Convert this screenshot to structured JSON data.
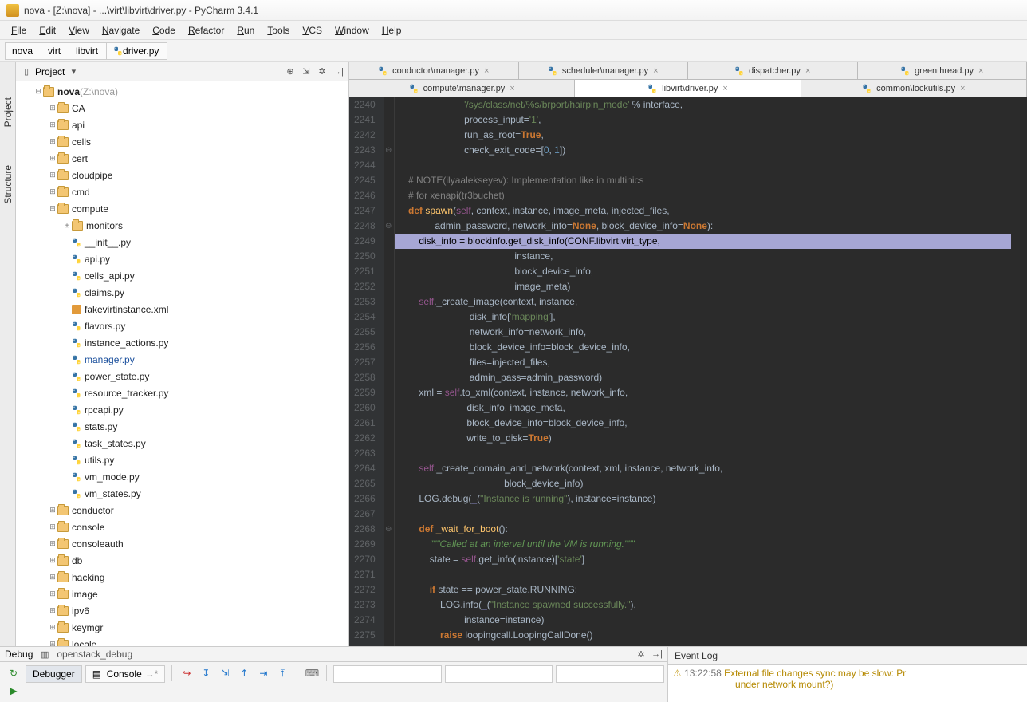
{
  "window": {
    "title": "nova - [Z:\\nova] - ...\\virt\\libvirt\\driver.py - PyCharm 3.4.1"
  },
  "menu": [
    "File",
    "Edit",
    "View",
    "Navigate",
    "Code",
    "Refactor",
    "Run",
    "Tools",
    "VCS",
    "Window",
    "Help"
  ],
  "breadcrumbs": [
    {
      "label": "nova",
      "icon": "folder"
    },
    {
      "label": "virt",
      "icon": "none"
    },
    {
      "label": "libvirt",
      "icon": "none"
    },
    {
      "label": "driver.py",
      "icon": "python"
    }
  ],
  "side_tabs": [
    "Project",
    "Structure"
  ],
  "project_panel": {
    "title": "Project",
    "root": {
      "label": "nova",
      "hint": "(Z:\\nova)"
    }
  },
  "tree": [
    {
      "depth": 0,
      "exp": "-",
      "icon": "folder",
      "label": "nova",
      "hint": "(Z:\\nova)",
      "bold": true
    },
    {
      "depth": 1,
      "exp": "+",
      "icon": "folder",
      "label": "CA"
    },
    {
      "depth": 1,
      "exp": "+",
      "icon": "folder",
      "label": "api"
    },
    {
      "depth": 1,
      "exp": "+",
      "icon": "folder",
      "label": "cells"
    },
    {
      "depth": 1,
      "exp": "+",
      "icon": "folder",
      "label": "cert"
    },
    {
      "depth": 1,
      "exp": "+",
      "icon": "folder",
      "label": "cloudpipe"
    },
    {
      "depth": 1,
      "exp": "+",
      "icon": "folder",
      "label": "cmd"
    },
    {
      "depth": 1,
      "exp": "-",
      "icon": "folder",
      "label": "compute"
    },
    {
      "depth": 2,
      "exp": "+",
      "icon": "folder",
      "label": "monitors"
    },
    {
      "depth": 2,
      "exp": "",
      "icon": "python",
      "label": "__init__.py"
    },
    {
      "depth": 2,
      "exp": "",
      "icon": "python",
      "label": "api.py"
    },
    {
      "depth": 2,
      "exp": "",
      "icon": "python",
      "label": "cells_api.py"
    },
    {
      "depth": 2,
      "exp": "",
      "icon": "python",
      "label": "claims.py"
    },
    {
      "depth": 2,
      "exp": "",
      "icon": "xml",
      "label": "fakevirtinstance.xml"
    },
    {
      "depth": 2,
      "exp": "",
      "icon": "python",
      "label": "flavors.py"
    },
    {
      "depth": 2,
      "exp": "",
      "icon": "python",
      "label": "instance_actions.py"
    },
    {
      "depth": 2,
      "exp": "",
      "icon": "python",
      "label": "manager.py",
      "active": true
    },
    {
      "depth": 2,
      "exp": "",
      "icon": "python",
      "label": "power_state.py"
    },
    {
      "depth": 2,
      "exp": "",
      "icon": "python",
      "label": "resource_tracker.py"
    },
    {
      "depth": 2,
      "exp": "",
      "icon": "python",
      "label": "rpcapi.py"
    },
    {
      "depth": 2,
      "exp": "",
      "icon": "python",
      "label": "stats.py"
    },
    {
      "depth": 2,
      "exp": "",
      "icon": "python",
      "label": "task_states.py"
    },
    {
      "depth": 2,
      "exp": "",
      "icon": "python",
      "label": "utils.py"
    },
    {
      "depth": 2,
      "exp": "",
      "icon": "python",
      "label": "vm_mode.py"
    },
    {
      "depth": 2,
      "exp": "",
      "icon": "python",
      "label": "vm_states.py"
    },
    {
      "depth": 1,
      "exp": "+",
      "icon": "folder",
      "label": "conductor"
    },
    {
      "depth": 1,
      "exp": "+",
      "icon": "folder",
      "label": "console"
    },
    {
      "depth": 1,
      "exp": "+",
      "icon": "folder",
      "label": "consoleauth"
    },
    {
      "depth": 1,
      "exp": "+",
      "icon": "folder",
      "label": "db"
    },
    {
      "depth": 1,
      "exp": "+",
      "icon": "folder",
      "label": "hacking"
    },
    {
      "depth": 1,
      "exp": "+",
      "icon": "folder",
      "label": "image"
    },
    {
      "depth": 1,
      "exp": "+",
      "icon": "folder",
      "label": "ipv6"
    },
    {
      "depth": 1,
      "exp": "+",
      "icon": "folder",
      "label": "keymgr"
    },
    {
      "depth": 1,
      "exp": "+",
      "icon": "folder",
      "label": "locale"
    }
  ],
  "tabs_row1": [
    {
      "label": "conductor\\manager.py",
      "close": true
    },
    {
      "label": "scheduler\\manager.py",
      "close": true
    },
    {
      "label": "dispatcher.py",
      "close": true
    },
    {
      "label": "greenthread.py",
      "close": true
    }
  ],
  "tabs_row2": [
    {
      "label": "compute\\manager.py",
      "close": true
    },
    {
      "label": "libvirt\\driver.py",
      "close": true,
      "active": true
    },
    {
      "label": "common\\lockutils.py",
      "close": true
    }
  ],
  "code_start_line": 2240,
  "code_lines": [
    "                         <span class='str'>'/sys/class/net/%s/brport/hairpin_mode'</span> <span class='op'>%</span> interface,",
    "                         <span class='param'>process_input</span><span class='op'>=</span><span class='str'>'1'</span>,",
    "                         <span class='param'>run_as_root</span><span class='op'>=</span><span class='kw'>True</span>,",
    "                         <span class='param'>check_exit_code</span><span class='op'>=</span>[<span class='num'>0</span>, <span class='num'>1</span>])",
    "",
    "    <span class='cmt'># NOTE(ilyaalekseyev): Implementation like in multinics</span>",
    "    <span class='cmt'># for xenapi(tr3buchet)</span>",
    "    <span class='kw'>def </span><span class='fn'>spawn</span>(<span class='self'>self</span>, context, instance, image_meta, injected_files,",
    "              admin_password, <span class='param'>network_info</span><span class='op'>=</span><span class='kw'>None</span>, <span class='param'>block_device_info</span><span class='op'>=</span><span class='kw'>None</span>):",
    "        disk_info = blockinfo.get_disk_info(CONF.libvirt.virt_type,",
    "                                            instance,",
    "                                            block_device_info,",
    "                                            image_meta)",
    "        <span class='self'>self</span>._create_image(context, instance,",
    "                           disk_info[<span class='str'>'mapping'</span>],",
    "                           <span class='param'>network_info</span><span class='op'>=</span>network_info,",
    "                           <span class='param'>block_device_info</span><span class='op'>=</span>block_device_info,",
    "                           <span class='param'>files</span><span class='op'>=</span>injected_files,",
    "                           <span class='param'>admin_pass</span><span class='op'>=</span>admin_password)",
    "        xml = <span class='self'>self</span>.to_xml(context, instance, network_info,",
    "                          disk_info, image_meta,",
    "                          <span class='param'>block_device_info</span><span class='op'>=</span>block_device_info,",
    "                          <span class='param'>write_to_disk</span><span class='op'>=</span><span class='kw'>True</span>)",
    "",
    "        <span class='self'>self</span>._create_domain_and_network(context, xml, instance, network_info,",
    "                                        block_device_info)",
    "        LOG.debug(<span class='builtin'>_</span>(<span class='str'>\"Instance is running\"</span>), <span class='param'>instance</span><span class='op'>=</span>instance)",
    "",
    "        <span class='kw'>def </span><span class='fn'>_wait_for_boot</span>():",
    "            <span class='doc'>\"\"\"Called at an interval until the VM is running.\"\"\"</span>",
    "            state = <span class='self'>self</span>.get_info(instance)[<span class='str'>'state'</span>]",
    "",
    "            <span class='kw'>if</span> state == power_state.RUNNING:",
    "                LOG.info(<span class='builtin'>_</span>(<span class='str'>\"Instance spawned successfully.\"</span>),",
    "                         <span class='param'>instance</span><span class='op'>=</span>instance)",
    "                <span class='kw'>raise</span> loopingcall.LoopingCallDone()"
  ],
  "highlight_line_index": 9,
  "fold_markers": {
    "3": "⊖",
    "8": "⊖",
    "28": "⊖"
  },
  "debug": {
    "title": "Debug",
    "config": "openstack_debug",
    "tabs": [
      "Debugger",
      "Console"
    ]
  },
  "event_log": {
    "title": "Event Log",
    "timestamp": "13:22:58",
    "message_line1": "External file changes sync may be slow: Pr",
    "message_line2": "under network mount?)"
  }
}
